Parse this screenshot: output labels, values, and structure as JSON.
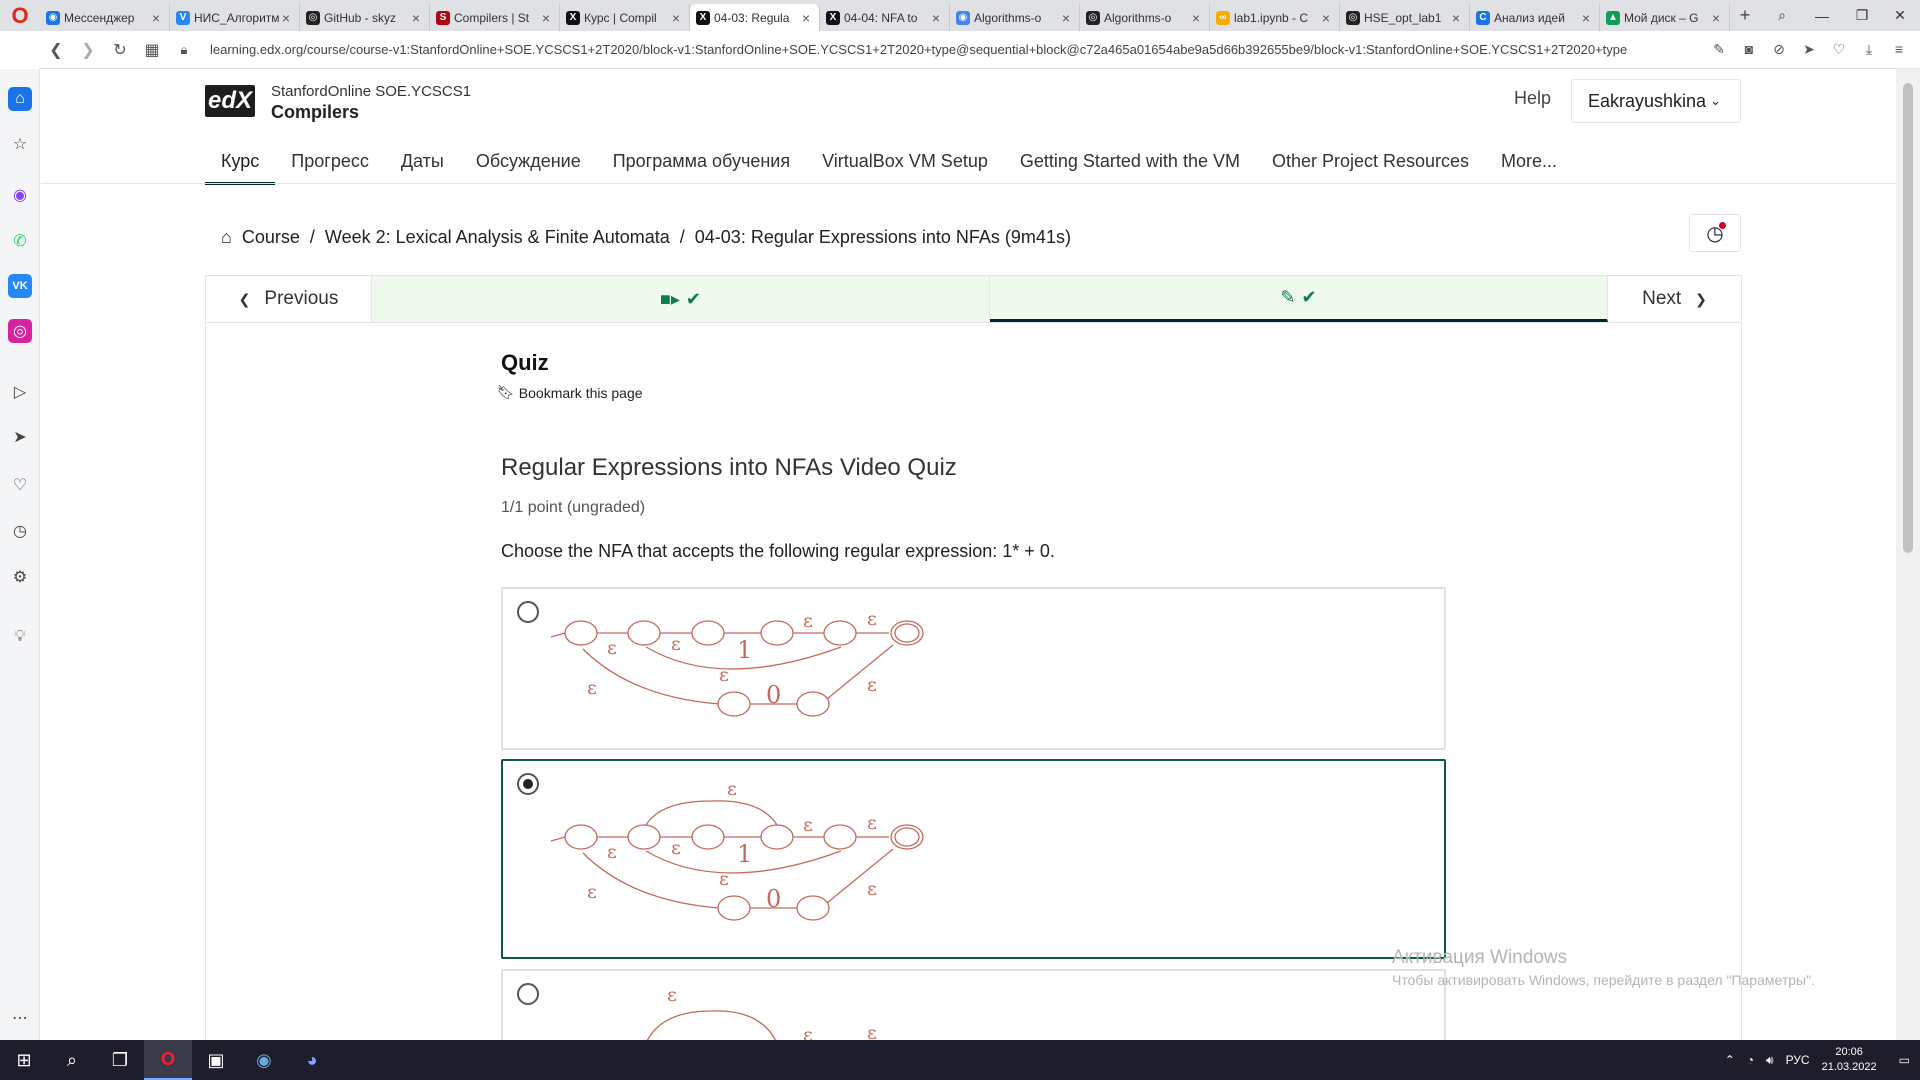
{
  "browser": {
    "tabs": [
      {
        "title": "Мессенджер",
        "color": "#1a73e8",
        "glyph": "◉"
      },
      {
        "title": "НИС_Алгоритмы",
        "color": "#2787f5",
        "glyph": "V"
      },
      {
        "title": "GitHub - skyz",
        "color": "#222222",
        "glyph": "◎"
      },
      {
        "title": "Compilers | St",
        "color": "#b1040e",
        "glyph": "S"
      },
      {
        "title": "Курс | Compil",
        "color": "#111111",
        "glyph": "X"
      },
      {
        "title": "04-03: Regula",
        "color": "#111111",
        "glyph": "X"
      },
      {
        "title": "04-04: NFA to",
        "color": "#111111",
        "glyph": "X"
      },
      {
        "title": "Algorithms-o",
        "color": "#4285f4",
        "glyph": "◉"
      },
      {
        "title": "Algorithms-o",
        "color": "#222222",
        "glyph": "◎"
      },
      {
        "title": "lab1.ipynb - C",
        "color": "#f9ab00",
        "glyph": "∞"
      },
      {
        "title": "HSE_opt_lab1",
        "color": "#222222",
        "glyph": "◎"
      },
      {
        "title": "Анализ идей",
        "color": "#1a73e8",
        "glyph": "C"
      },
      {
        "title": "Мой диск – G",
        "color": "#0f9d58",
        "glyph": "▲"
      }
    ],
    "active_tab_index": 5,
    "url": "learning.edx.org/course/course-v1:StanfordOnline+SOE.YCSCS1+2T2020/block-v1:StanfordOnline+SOE.YCSCS1+2T2020+type@sequential+block@c72a465a01654abe9a5d66b392655be9/block-v1:StanfordOnline+SOE.YCSCS1+2T2020+type"
  },
  "header": {
    "logo_text": "edX",
    "course_org": "StanfordOnline SOE.YCSCS1",
    "course_title": "Compilers",
    "help_label": "Help",
    "username": "Eakrayushkina"
  },
  "course_nav": {
    "tabs": [
      "Курс",
      "Прогресс",
      "Даты",
      "Обсуждение",
      "Программа обучения",
      "VirtualBox VM Setup",
      "Getting Started with the VM",
      "Other Project Resources",
      "More..."
    ],
    "active_index": 0
  },
  "breadcrumb": {
    "home": "Course",
    "week": "Week 2: Lexical Analysis & Finite Automata",
    "unit": "04-03: Regular Expressions into NFAs (9m41s)"
  },
  "sequence": {
    "previous_label": "Previous",
    "next_label": "Next"
  },
  "problem": {
    "heading": "Quiz",
    "bookmark_label": "Bookmark this page",
    "title": "Regular Expressions into NFAs Video Quiz",
    "points": "1/1 point (ungraded)",
    "question": "Choose the NFA that accepts the following regular expression: 1* + 0.",
    "epsilon": "ε",
    "one": "1",
    "zero": "0",
    "selected_index": 1,
    "accent_color": "#0d5b36",
    "nfa_color": "#c36a5e"
  },
  "watermark": {
    "line1": "Активация Windows",
    "line2": "Чтобы активировать Windows, перейдите в раздел \"Параметры\"."
  },
  "taskbar": {
    "lang": "РУС",
    "time": "20:06",
    "date": "21.03.2022"
  }
}
